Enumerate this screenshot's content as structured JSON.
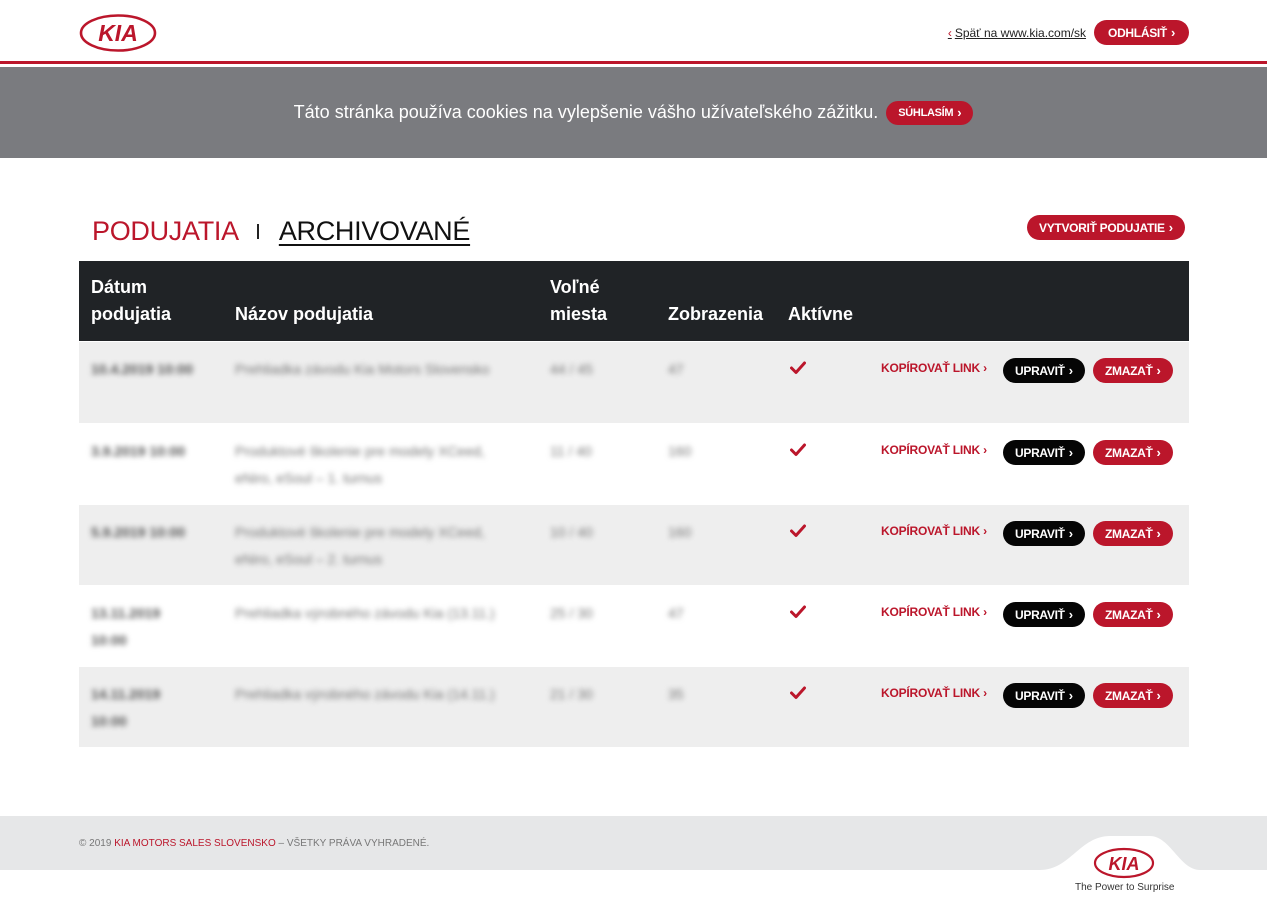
{
  "header": {
    "logo_text": "KIA",
    "back_link": "Späť na www.kia.com/sk",
    "logout_label": "ODHLÁSIŤ"
  },
  "cookie_bar": {
    "message": "Táto stránka používa cookies na vylepšenie vášho užívateľského zážitku.",
    "accept_label": "SÚHLASÍM"
  },
  "page": {
    "tab_active": "PODUJATIA",
    "tab_archive": "ARCHIVOVANÉ",
    "create_label": "VYTVORIŤ PODUJATIE"
  },
  "table": {
    "headers": {
      "date_line1": "Dátum",
      "date_line2": "podujatia",
      "name": "Názov podujatia",
      "seats_line1": "Voľné",
      "seats_line2": "miesta",
      "views": "Zobrazenia",
      "active": "Aktívne"
    },
    "rows": [
      {
        "date_line1": "10.4.2019 10:00",
        "date_line2": "",
        "name_line1": "Prehliadka závodu Kia Motors Slovensko",
        "name_line2": "",
        "seats": "44 / 45",
        "views": "47",
        "active": true
      },
      {
        "date_line1": "3.9.2019 10:00",
        "date_line2": "",
        "name_line1": "Produktové školenie pre modely XCeed,",
        "name_line2": "eNiro, eSoul – 1. turnus",
        "seats": "11 / 40",
        "views": "160",
        "active": true
      },
      {
        "date_line1": "5.9.2019 10:00",
        "date_line2": "",
        "name_line1": "Produktové školenie pre modely XCeed,",
        "name_line2": "eNiro, eSoul – 2. turnus",
        "seats": "10 / 40",
        "views": "160",
        "active": true
      },
      {
        "date_line1": "13.11.2019",
        "date_line2": "10:00",
        "name_line1": "Prehliadka výrobného závodu Kia (13.11.)",
        "name_line2": "",
        "seats": "25 / 30",
        "views": "47",
        "active": true
      },
      {
        "date_line1": "14.11.2019",
        "date_line2": "10:00",
        "name_line1": "Prehliadka výrobného závodu Kia (14.11.)",
        "name_line2": "",
        "seats": "21 / 30",
        "views": "35",
        "active": true
      }
    ],
    "actions": {
      "copy_link": "KOPÍROVAŤ LINK",
      "edit": "UPRAVIŤ",
      "delete": "ZMAZAŤ"
    }
  },
  "footer": {
    "copyright_prefix": "© 2019",
    "company": "KIA MOTORS SALES SLOVENSKO",
    "rights": "– VŠETKY PRÁVA VYHRADENÉ.",
    "logo_text": "KIA",
    "tagline": "The Power to Surprise"
  },
  "colors": {
    "brand_red": "#bb162b",
    "table_header": "#202326",
    "cookie_bar": "#7a7b7f",
    "footer": "#e6e7e8"
  }
}
